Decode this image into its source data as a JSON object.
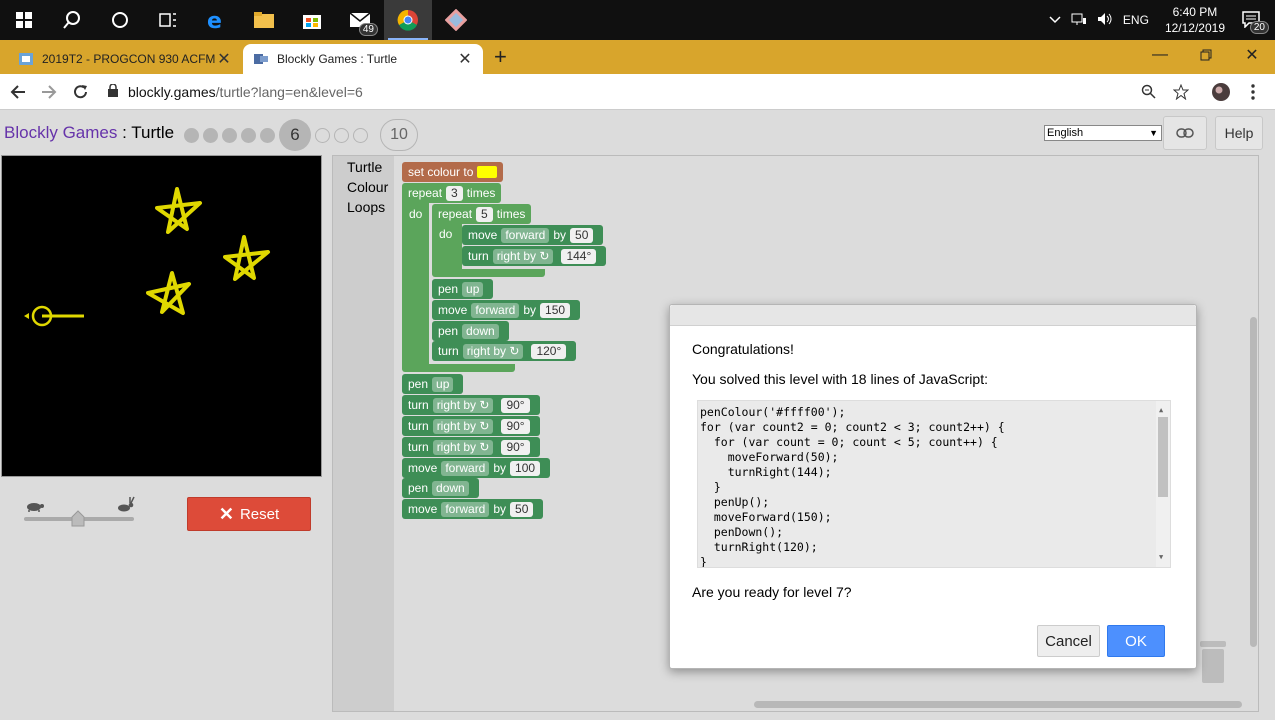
{
  "taskbar": {
    "mail_badge": "49",
    "tray_lang": "ENG",
    "time": "6:40 PM",
    "date": "12/12/2019",
    "notif_badge": "20"
  },
  "tabs": [
    {
      "title": "2019T2 - PROGCON 930 ACFM |"
    },
    {
      "title": "Blockly Games : Turtle"
    }
  ],
  "address": {
    "domain": "blockly.games",
    "path": "/turtle?lang=en&level=6"
  },
  "header": {
    "title_link": "Blockly Games",
    "title_rest": " : Turtle",
    "current_level": "6",
    "max_level": "10",
    "language": "English",
    "help_label": "Help"
  },
  "controls": {
    "reset_label": "Reset"
  },
  "toolbox": [
    "Turtle",
    "Colour",
    "Loops"
  ],
  "blocks": {
    "set_colour": "set colour to",
    "repeat": "repeat",
    "times": "times",
    "do": "do",
    "move": "move",
    "forward": "forward",
    "by": "by",
    "turn": "turn",
    "right_by": "right by ↻",
    "pen": "pen",
    "up": "up",
    "down": "down",
    "n3": "3",
    "n5": "5",
    "n50": "50",
    "a144": "144°",
    "n150": "150",
    "a120": "120°",
    "a90": "90°",
    "n100": "100"
  },
  "dialog": {
    "congrats": "Congratulations!",
    "solved": "You solved this level with 18 lines of JavaScript:",
    "question": "Are you ready for level 7?",
    "cancel_label": "Cancel",
    "ok_label": "OK",
    "code_lines": [
      "penColour('#ffff00');",
      "for (var count2 = 0; count2 < 3; count2++) {",
      "  for (var count = 0; count < 5; count++) {",
      "    moveForward(50);",
      "    turnRight(144);",
      "  }",
      "  penUp();",
      "  moveForward(150);",
      "  penDown();",
      "  turnRight(120);",
      "}"
    ]
  },
  "colors": {
    "turtle_block": "#3e8e56",
    "loop_block": "#5ba55b",
    "colour_block": "#b36b4a",
    "pen": "#ffff00",
    "reset": "#dd4b39",
    "ok": "#4d90fe"
  }
}
